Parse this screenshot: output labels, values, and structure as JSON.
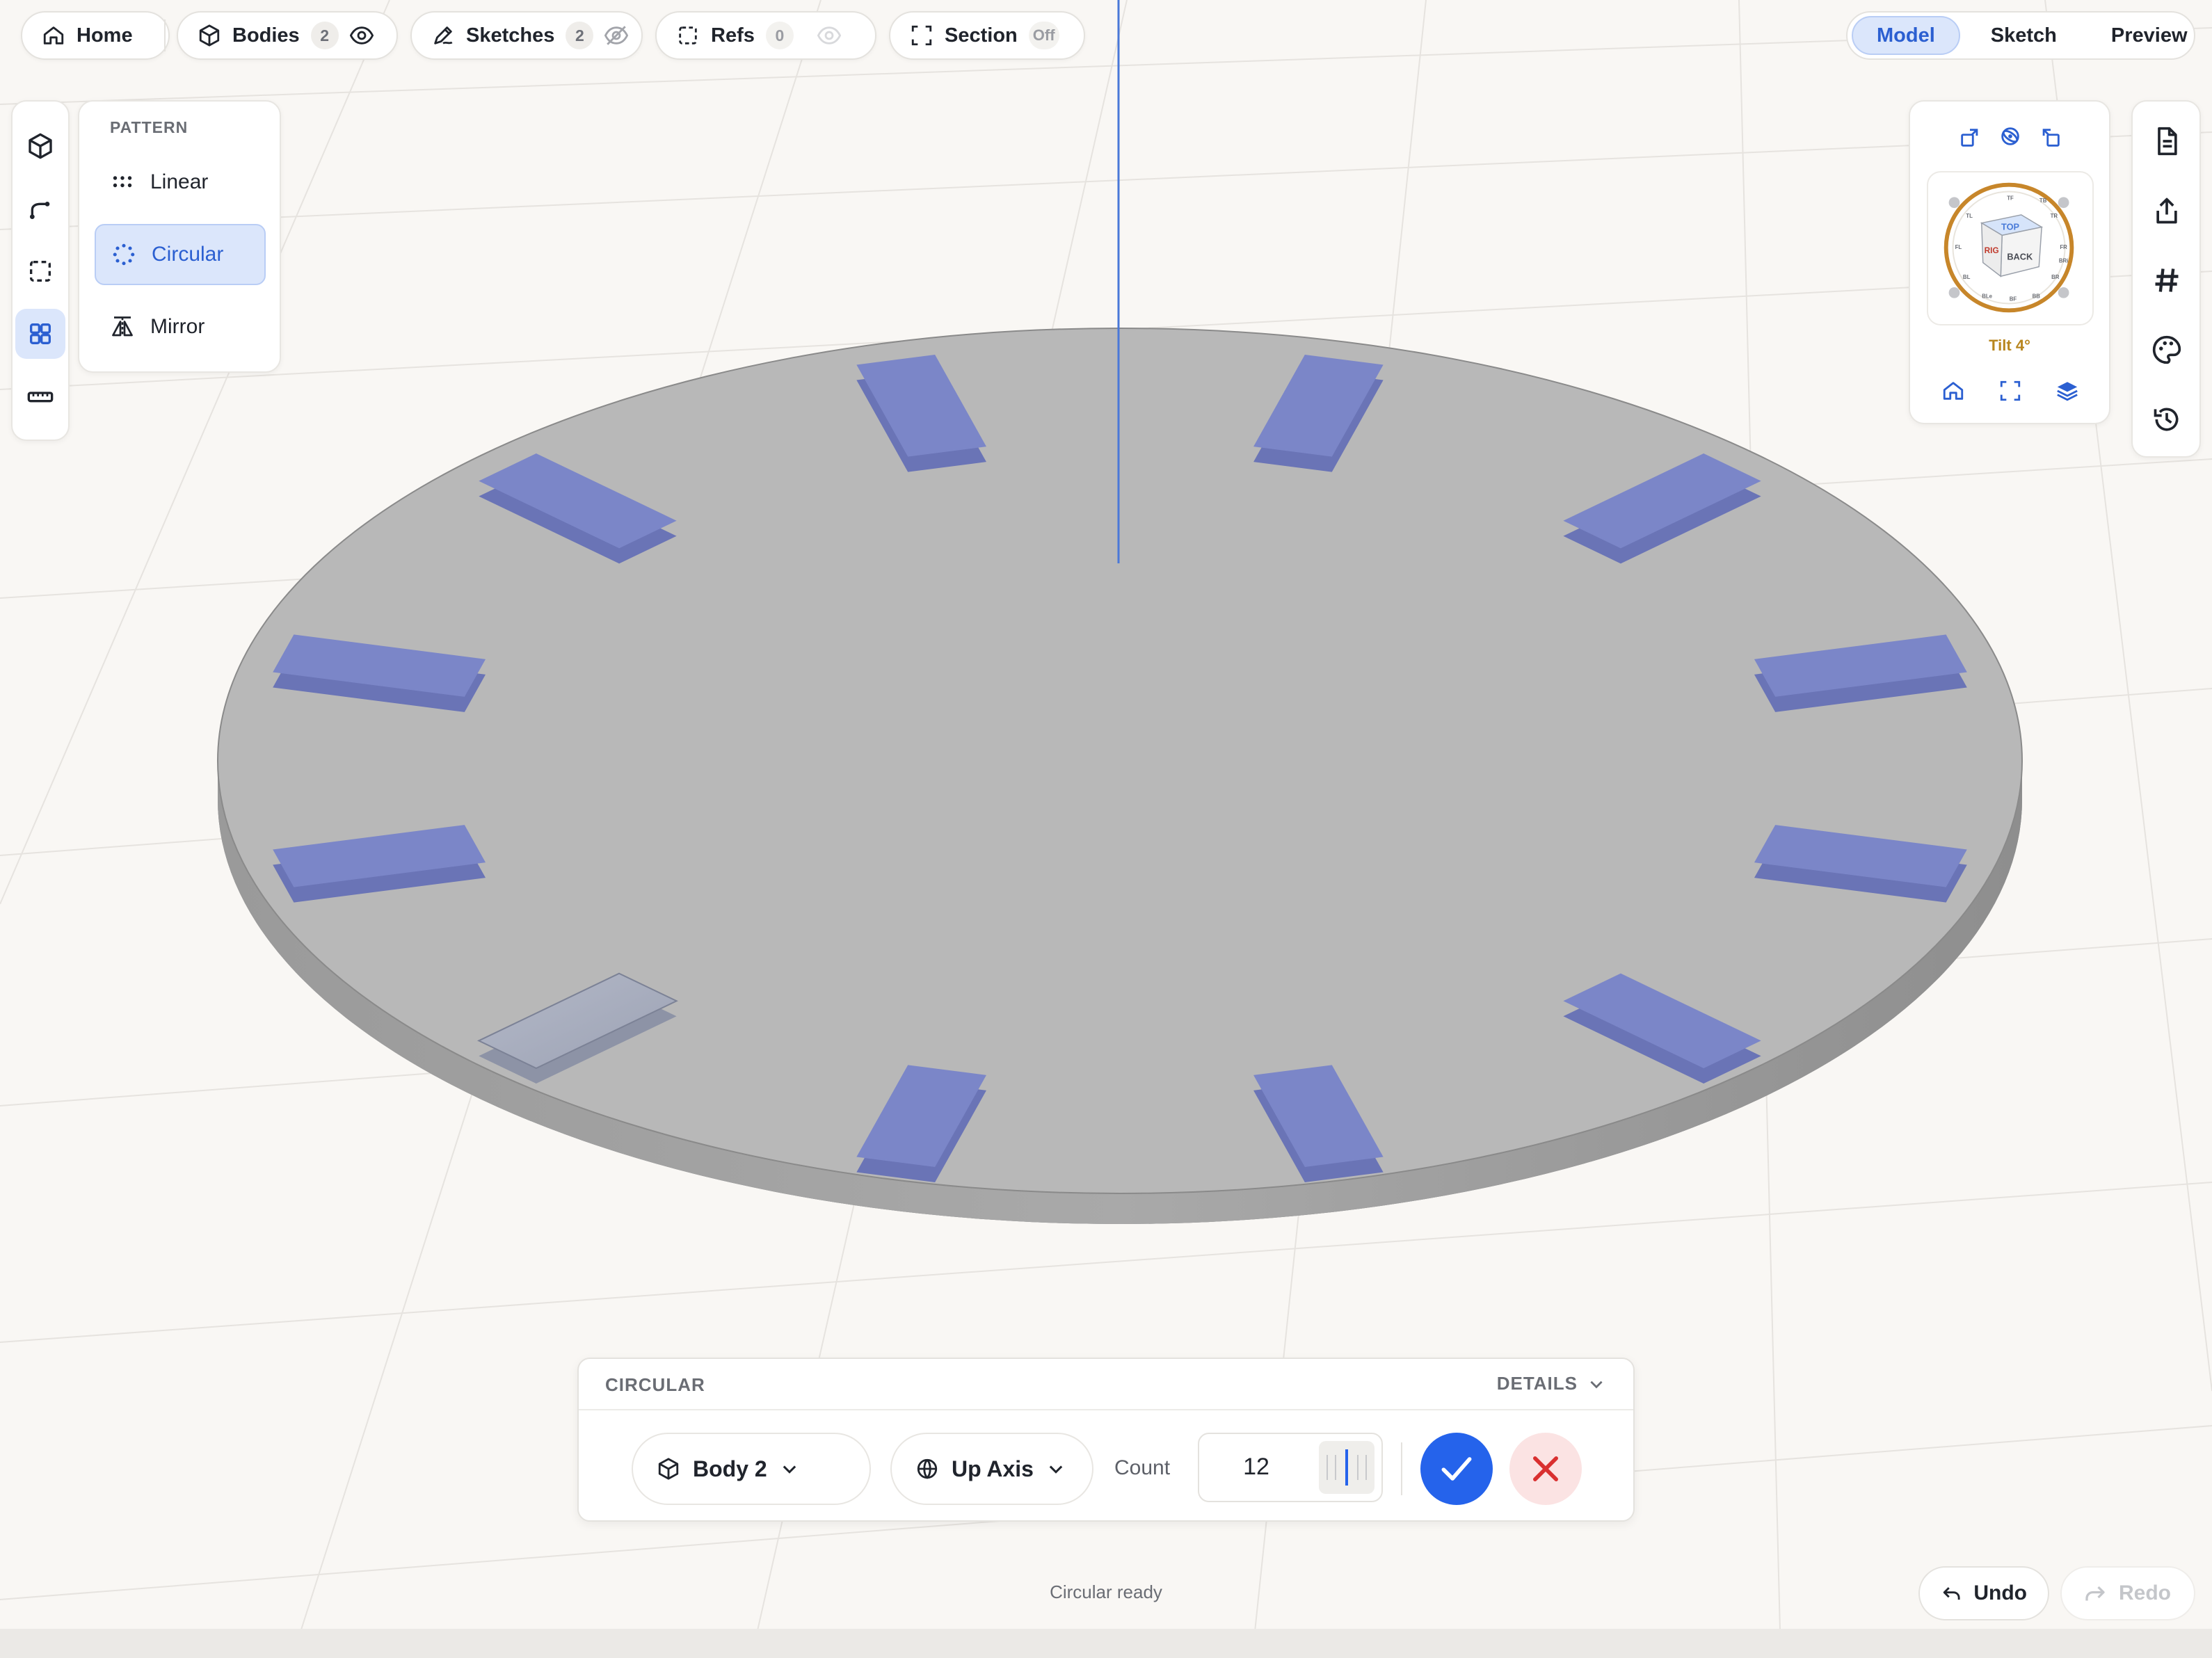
{
  "topbar": {
    "home_label": "Home",
    "bodies_label": "Bodies",
    "bodies_count": "2",
    "sketches_label": "Sketches",
    "sketches_count": "2",
    "refs_label": "Refs",
    "refs_count": "0",
    "section_label": "Section",
    "section_state": "Off"
  },
  "modes": {
    "model": "Model",
    "sketch": "Sketch",
    "preview": "Preview",
    "active": "Model"
  },
  "left_rail": {
    "items": [
      "body-icon",
      "sketch-icon",
      "select-icon",
      "pattern-icon",
      "measure-icon"
    ],
    "active": "pattern-icon"
  },
  "pattern_panel": {
    "title": "PATTERN",
    "items": [
      {
        "label": "Linear",
        "icon": "linear-pattern-icon"
      },
      {
        "label": "Circular",
        "icon": "circular-pattern-icon",
        "active": true
      },
      {
        "label": "Mirror",
        "icon": "mirror-icon"
      }
    ]
  },
  "view_panel": {
    "cube_faces": {
      "top": "TOP",
      "back": "BACK",
      "right": "RIG",
      "ring_labels": [
        "TL",
        "TF",
        "TB",
        "TR",
        "FL",
        "FR",
        "BRi",
        "BR",
        "BL",
        "BLe",
        "BF",
        "BB"
      ]
    },
    "tilt": "Tilt 4°"
  },
  "right_rail": {
    "items": [
      "document-icon",
      "share-icon",
      "hash-icon",
      "palette-icon",
      "history-icon"
    ]
  },
  "operation": {
    "title": "CIRCULAR",
    "details_label": "DETAILS",
    "body_value": "Body 2",
    "axis_value": "Up Axis",
    "count_label": "Count",
    "count_value": "12"
  },
  "status": "Circular ready",
  "history": {
    "undo": "Undo",
    "redo": "Redo",
    "redo_enabled": false
  },
  "colors": {
    "accent": "#2563eb",
    "pattern_preview": "#7b86c8",
    "disc": "#b6b6b6",
    "tilt": "#b8861f"
  },
  "scene": {
    "pattern_instance_count": 12,
    "selected_instance": "Body 2"
  }
}
